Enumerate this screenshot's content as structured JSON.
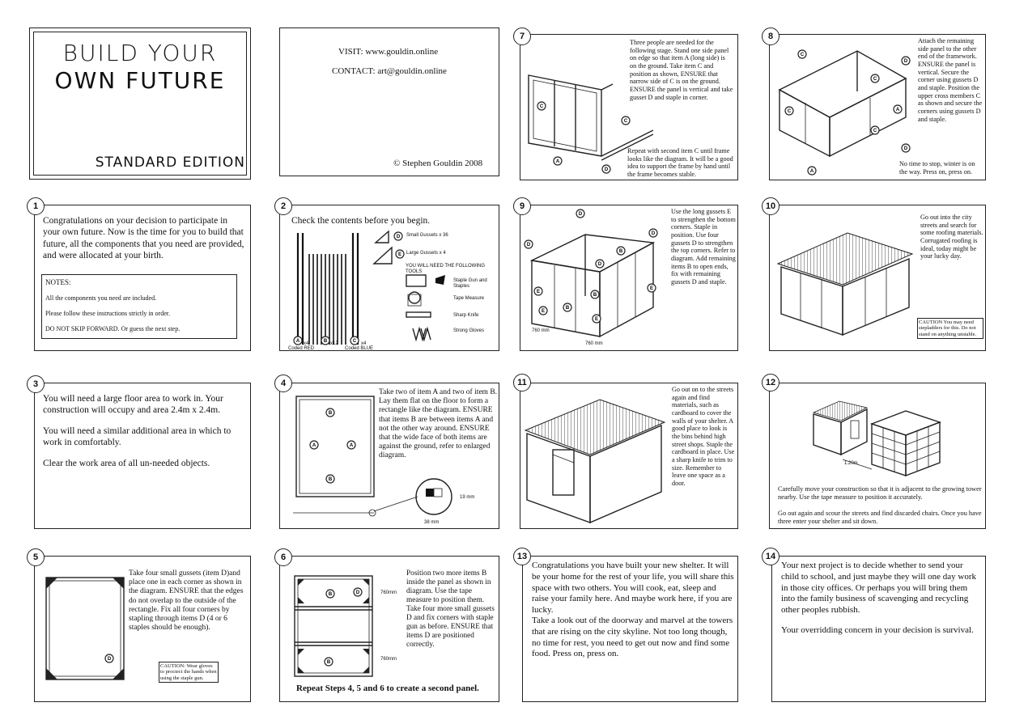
{
  "cover": {
    "title1": "BUILD YOUR",
    "title2": "OWN FUTURE",
    "edition": "STANDARD EDITION"
  },
  "contact": {
    "visit": "VISIT: www.gouldin.online",
    "contact": "CONTACT: art@gouldin.online",
    "copyright": "© Stephen Gouldin 2008"
  },
  "steps": {
    "s1": {
      "num": "1",
      "text": "Congratulations on your decision to participate in your own future. Now is the time for you to build that future, all the components that you need are provided, and were allocated at your birth.",
      "notes_title": "NOTES:",
      "note1": "All the components you need are included.",
      "note2": "Please follow these instructions strictly in order.",
      "note3": "DO NOT SKIP FORWARD. Or guess the next step."
    },
    "s2": {
      "num": "2",
      "text": "Check the contents before you begin.",
      "gusset_d": "Small Gussets x 36",
      "gusset_e": "Large Gussets x 4",
      "tools_title": "YOU WILL NEED THE FOLLOWING TOOLS",
      "tool1": "Staple Gun and Staples",
      "tool2": "Tape Measure",
      "tool3": "Sharp Knife",
      "tool4": "Strong Gloves",
      "label_a": "x4",
      "label_b": "x12",
      "label_c": "x4",
      "code_red": "Coded RED",
      "code_blue": "Coded BLUE"
    },
    "s3": {
      "num": "3",
      "p1": "You will need a large floor area to work in. Your construction will occupy and area 2.4m x 2.4m.",
      "p2": "You will need a similar additional area in which to work in comfortably.",
      "p3": "Clear the work area of all un-needed objects."
    },
    "s4": {
      "num": "4",
      "text": "Take two of item A and two of item B. Lay them flat on the floor to form a rectangle like the diagram. ENSURE that items B are between items A and not the other way around. ENSURE that the wide face of both items are against the ground, refer to enlarged diagram.",
      "dim1": "19 mm",
      "dim2": "38 mm"
    },
    "s5": {
      "num": "5",
      "text": "Take four small gussets (item D)and place one in each corner as shown in the diagram. ENSURE that the edges do not overlap to the outside of the rectangle. Fix all four corners by stapling through items D (4 or 6 staples should be enough).",
      "caution": "CAUTION: Wear gloves to proctect the hands when using the staple gun."
    },
    "s6": {
      "num": "6",
      "text": "Position two more items B inside the panel as shown in diagram. Use the tape measure to position them. Take four more small gussets D and fix corners with staple gun as before. ENSURE that items D are positioned correctly.",
      "repeat": "Repeat Steps 4, 5 and 6 to create a second panel.",
      "dim": "760mm"
    },
    "s7": {
      "num": "7",
      "text": "Three people are needed for the following stage. Stand one side panel on edge so that item A (long side) is on the ground. Take item C and position as shown, ENSURE that narrow side of C is on the ground. ENSURE the panel is vertical and take gusset D and staple in corner.",
      "text2": "Repeat with second item C until frame looks like the diagram. It will be a good idea to support the frame by hand until the frame becomes stable."
    },
    "s8": {
      "num": "8",
      "text": "Attach the remaining side panel to the other end of the framework. ENSURE the panel is vertical. Secure the corner using gussets D and staple. Position the upper cross members C as shown and secure the corners using gussets D and staple.",
      "text2": "No time to stop, winter is on the way. Press on, press on."
    },
    "s9": {
      "num": "9",
      "text": "Use the long gussets E to strengthen the bottom corners. Staple in position. Use four gussets D to strengthen the top corners. Refer to diagram. Add remaining items B to open ends, fix with remaining gussets D and staple.",
      "dim": "760 mm"
    },
    "s10": {
      "num": "10",
      "text": "Go out into the city streets and search for some roofing materials. Corrugated roofing is ideal, today might be your lucky day.",
      "caution": "CAUTION You may need stepladders for this. Do not stand on anything unstable."
    },
    "s11": {
      "num": "11",
      "text": "Go out on to the streets again and find materials, such as cardboard to cover the walls of your shelter. A good place to look is the bins behind high street shops. Staple the cardboard in place. Use a sharp knife to trim to size. Remember to leave one space as a door."
    },
    "s12": {
      "num": "12",
      "dim": "1.20m",
      "text": "Carefully move your construction so that it is adjacent to the growing tower nearby. Use the tape measure to position it accurately.",
      "text2": "Go out again and scour the streets and find discarded chairs. Once you have three enter your shelter and sit down."
    },
    "s13": {
      "num": "13",
      "text": "Congratulations you have built your new shelter. It will be your home for the rest of your life, you will share this space with two others. You will cook, eat, sleep and raise your family here. And maybe work here, if you are lucky.",
      "text2": "Take a look out of the doorway and marvel at the towers that are rising on the city skyline. Not too long though, no time for rest, you need to get out now and find some food. Press on, press on."
    },
    "s14": {
      "num": "14",
      "p1": "Your next project is to decide whether to send your child to school, and just maybe they will one day work in those city offices. Or perhaps you will bring them into the family business of scavenging and recycling other peoples rubbish.",
      "p2": "Your overridding concern in your decision is survival."
    }
  },
  "labels": {
    "a": "A",
    "b": "B",
    "c": "C",
    "d": "D",
    "e": "E"
  }
}
